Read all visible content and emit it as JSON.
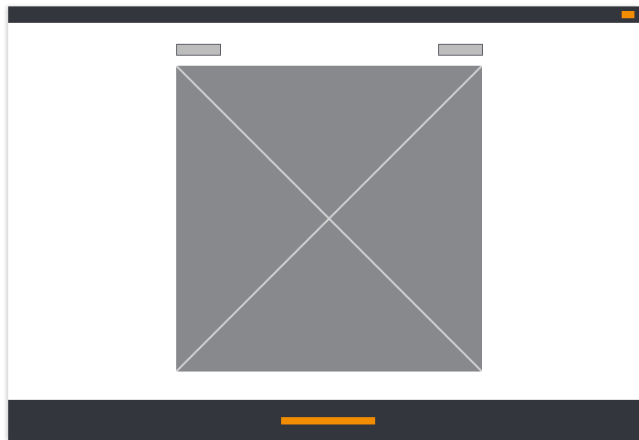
{
  "colors": {
    "dark_bar": "#34363d",
    "accent": "#f28c00",
    "button_fill": "#bdbdbd",
    "image_placeholder": "#88898d",
    "placeholder_lines": "#d6d6d6"
  },
  "header": {
    "accent_icon": "orange-rectangle-marker"
  },
  "main": {
    "left_button": {
      "icon": "blank-button"
    },
    "right_button": {
      "icon": "blank-button"
    },
    "image": {
      "icon": "image-placeholder-x"
    }
  },
  "footer": {
    "action_bar": {
      "icon": "orange-bar-button"
    }
  }
}
